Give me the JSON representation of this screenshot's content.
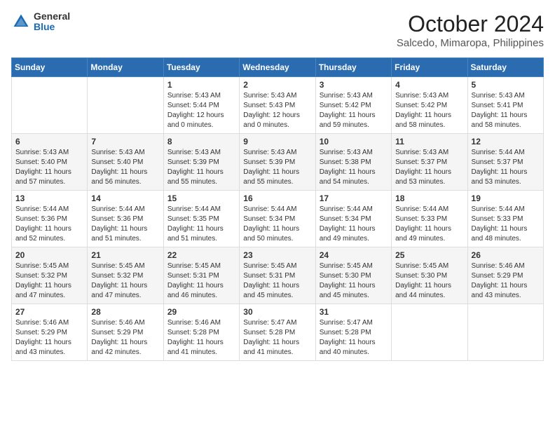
{
  "logo": {
    "general": "General",
    "blue": "Blue"
  },
  "header": {
    "month": "October 2024",
    "location": "Salcedo, Mimaropa, Philippines"
  },
  "weekdays": [
    "Sunday",
    "Monday",
    "Tuesday",
    "Wednesday",
    "Thursday",
    "Friday",
    "Saturday"
  ],
  "weeks": [
    [
      {
        "day": "",
        "info": ""
      },
      {
        "day": "",
        "info": ""
      },
      {
        "day": "1",
        "info": "Sunrise: 5:43 AM\nSunset: 5:44 PM\nDaylight: 12 hours\nand 0 minutes."
      },
      {
        "day": "2",
        "info": "Sunrise: 5:43 AM\nSunset: 5:43 PM\nDaylight: 12 hours\nand 0 minutes."
      },
      {
        "day": "3",
        "info": "Sunrise: 5:43 AM\nSunset: 5:42 PM\nDaylight: 11 hours\nand 59 minutes."
      },
      {
        "day": "4",
        "info": "Sunrise: 5:43 AM\nSunset: 5:42 PM\nDaylight: 11 hours\nand 58 minutes."
      },
      {
        "day": "5",
        "info": "Sunrise: 5:43 AM\nSunset: 5:41 PM\nDaylight: 11 hours\nand 58 minutes."
      }
    ],
    [
      {
        "day": "6",
        "info": "Sunrise: 5:43 AM\nSunset: 5:40 PM\nDaylight: 11 hours\nand 57 minutes."
      },
      {
        "day": "7",
        "info": "Sunrise: 5:43 AM\nSunset: 5:40 PM\nDaylight: 11 hours\nand 56 minutes."
      },
      {
        "day": "8",
        "info": "Sunrise: 5:43 AM\nSunset: 5:39 PM\nDaylight: 11 hours\nand 55 minutes."
      },
      {
        "day": "9",
        "info": "Sunrise: 5:43 AM\nSunset: 5:39 PM\nDaylight: 11 hours\nand 55 minutes."
      },
      {
        "day": "10",
        "info": "Sunrise: 5:43 AM\nSunset: 5:38 PM\nDaylight: 11 hours\nand 54 minutes."
      },
      {
        "day": "11",
        "info": "Sunrise: 5:43 AM\nSunset: 5:37 PM\nDaylight: 11 hours\nand 53 minutes."
      },
      {
        "day": "12",
        "info": "Sunrise: 5:44 AM\nSunset: 5:37 PM\nDaylight: 11 hours\nand 53 minutes."
      }
    ],
    [
      {
        "day": "13",
        "info": "Sunrise: 5:44 AM\nSunset: 5:36 PM\nDaylight: 11 hours\nand 52 minutes."
      },
      {
        "day": "14",
        "info": "Sunrise: 5:44 AM\nSunset: 5:36 PM\nDaylight: 11 hours\nand 51 minutes."
      },
      {
        "day": "15",
        "info": "Sunrise: 5:44 AM\nSunset: 5:35 PM\nDaylight: 11 hours\nand 51 minutes."
      },
      {
        "day": "16",
        "info": "Sunrise: 5:44 AM\nSunset: 5:34 PM\nDaylight: 11 hours\nand 50 minutes."
      },
      {
        "day": "17",
        "info": "Sunrise: 5:44 AM\nSunset: 5:34 PM\nDaylight: 11 hours\nand 49 minutes."
      },
      {
        "day": "18",
        "info": "Sunrise: 5:44 AM\nSunset: 5:33 PM\nDaylight: 11 hours\nand 49 minutes."
      },
      {
        "day": "19",
        "info": "Sunrise: 5:44 AM\nSunset: 5:33 PM\nDaylight: 11 hours\nand 48 minutes."
      }
    ],
    [
      {
        "day": "20",
        "info": "Sunrise: 5:45 AM\nSunset: 5:32 PM\nDaylight: 11 hours\nand 47 minutes."
      },
      {
        "day": "21",
        "info": "Sunrise: 5:45 AM\nSunset: 5:32 PM\nDaylight: 11 hours\nand 47 minutes."
      },
      {
        "day": "22",
        "info": "Sunrise: 5:45 AM\nSunset: 5:31 PM\nDaylight: 11 hours\nand 46 minutes."
      },
      {
        "day": "23",
        "info": "Sunrise: 5:45 AM\nSunset: 5:31 PM\nDaylight: 11 hours\nand 45 minutes."
      },
      {
        "day": "24",
        "info": "Sunrise: 5:45 AM\nSunset: 5:30 PM\nDaylight: 11 hours\nand 45 minutes."
      },
      {
        "day": "25",
        "info": "Sunrise: 5:45 AM\nSunset: 5:30 PM\nDaylight: 11 hours\nand 44 minutes."
      },
      {
        "day": "26",
        "info": "Sunrise: 5:46 AM\nSunset: 5:29 PM\nDaylight: 11 hours\nand 43 minutes."
      }
    ],
    [
      {
        "day": "27",
        "info": "Sunrise: 5:46 AM\nSunset: 5:29 PM\nDaylight: 11 hours\nand 43 minutes."
      },
      {
        "day": "28",
        "info": "Sunrise: 5:46 AM\nSunset: 5:29 PM\nDaylight: 11 hours\nand 42 minutes."
      },
      {
        "day": "29",
        "info": "Sunrise: 5:46 AM\nSunset: 5:28 PM\nDaylight: 11 hours\nand 41 minutes."
      },
      {
        "day": "30",
        "info": "Sunrise: 5:47 AM\nSunset: 5:28 PM\nDaylight: 11 hours\nand 41 minutes."
      },
      {
        "day": "31",
        "info": "Sunrise: 5:47 AM\nSunset: 5:28 PM\nDaylight: 11 hours\nand 40 minutes."
      },
      {
        "day": "",
        "info": ""
      },
      {
        "day": "",
        "info": ""
      }
    ]
  ]
}
